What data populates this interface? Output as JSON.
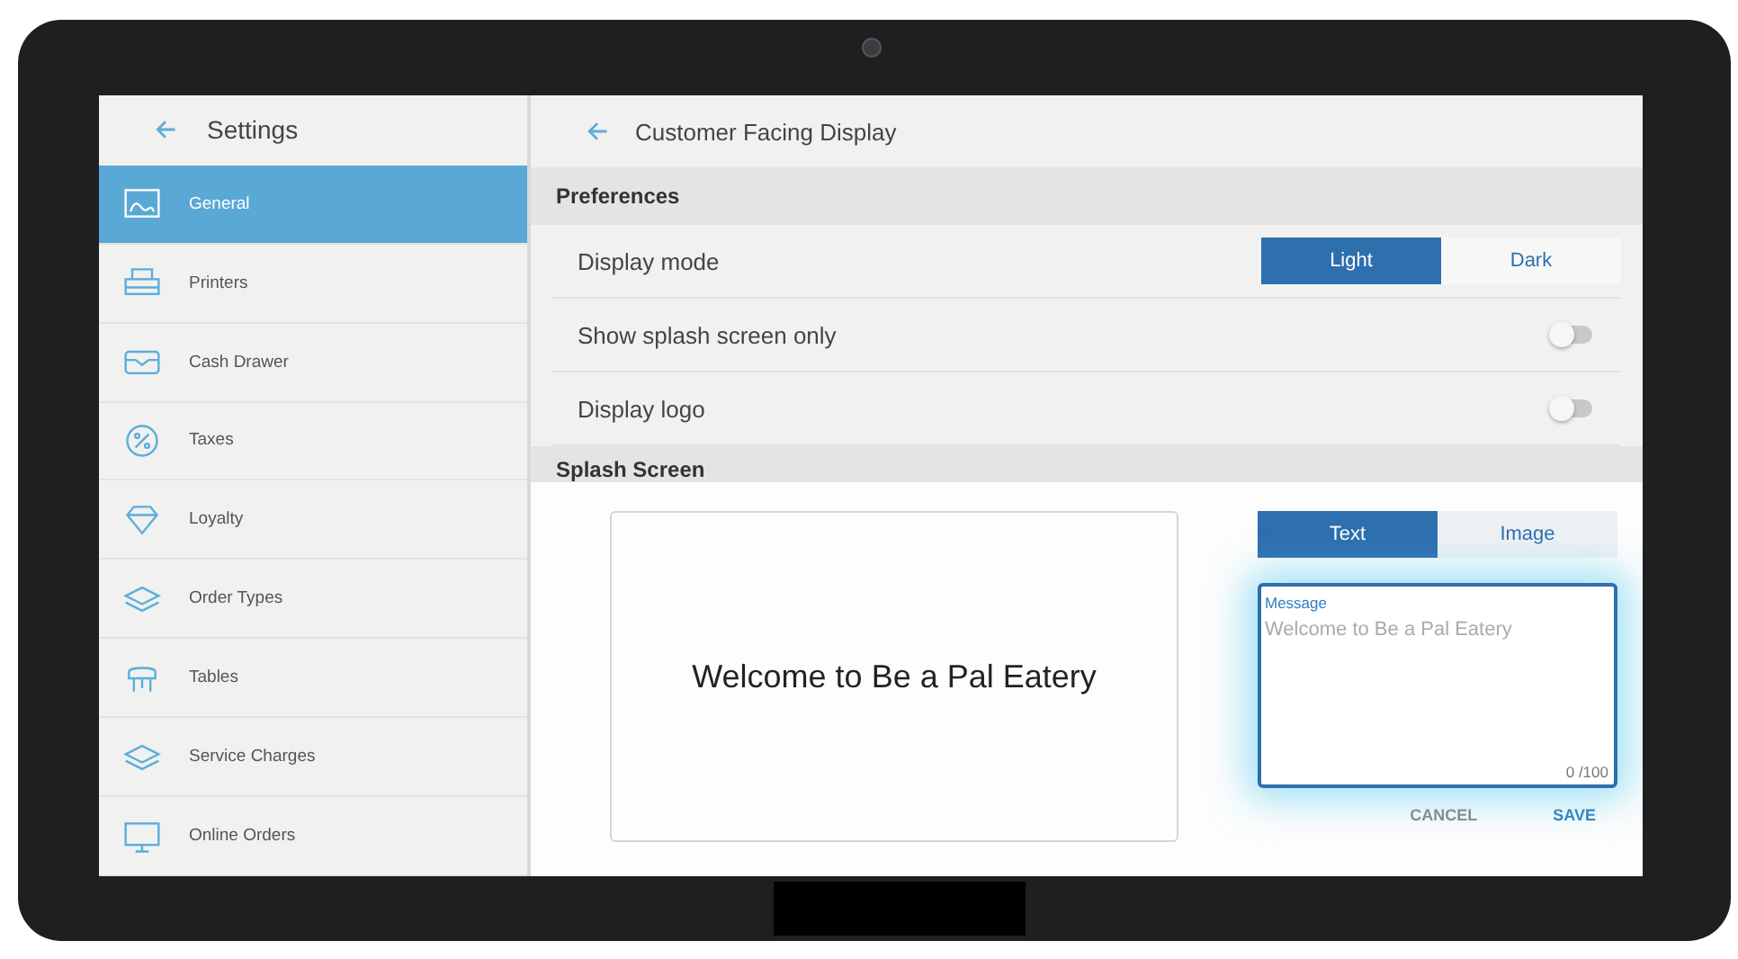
{
  "sidebar": {
    "title": "Settings",
    "items": [
      {
        "label": "General",
        "selected": true
      },
      {
        "label": "Printers",
        "selected": false
      },
      {
        "label": "Cash Drawer",
        "selected": false
      },
      {
        "label": "Taxes",
        "selected": false
      },
      {
        "label": "Loyalty",
        "selected": false
      },
      {
        "label": "Order Types",
        "selected": false
      },
      {
        "label": "Tables",
        "selected": false
      },
      {
        "label": "Service Charges",
        "selected": false
      },
      {
        "label": "Online Orders",
        "selected": false
      }
    ]
  },
  "main": {
    "title": "Customer Facing Display",
    "preferences": {
      "heading": "Preferences",
      "rows": [
        {
          "kind": "segmented",
          "label": "Display mode",
          "options": [
            {
              "label": "Light",
              "selected": true
            },
            {
              "label": "Dark",
              "selected": false
            }
          ]
        },
        {
          "kind": "toggle",
          "label": "Show splash screen only",
          "on": false
        },
        {
          "kind": "toggle",
          "label": "Display logo",
          "on": false
        }
      ]
    },
    "splash": {
      "heading": "Splash Screen",
      "preview_text": "Welcome to Be a Pal Eatery",
      "tabs": [
        {
          "label": "Text",
          "selected": true
        },
        {
          "label": "Image",
          "selected": false
        }
      ],
      "message": {
        "label": "Message",
        "placeholder": "Welcome to Be a Pal Eatery",
        "counter": "0 /100"
      },
      "buttons": [
        "CANCEL",
        "SAVE"
      ]
    }
  }
}
